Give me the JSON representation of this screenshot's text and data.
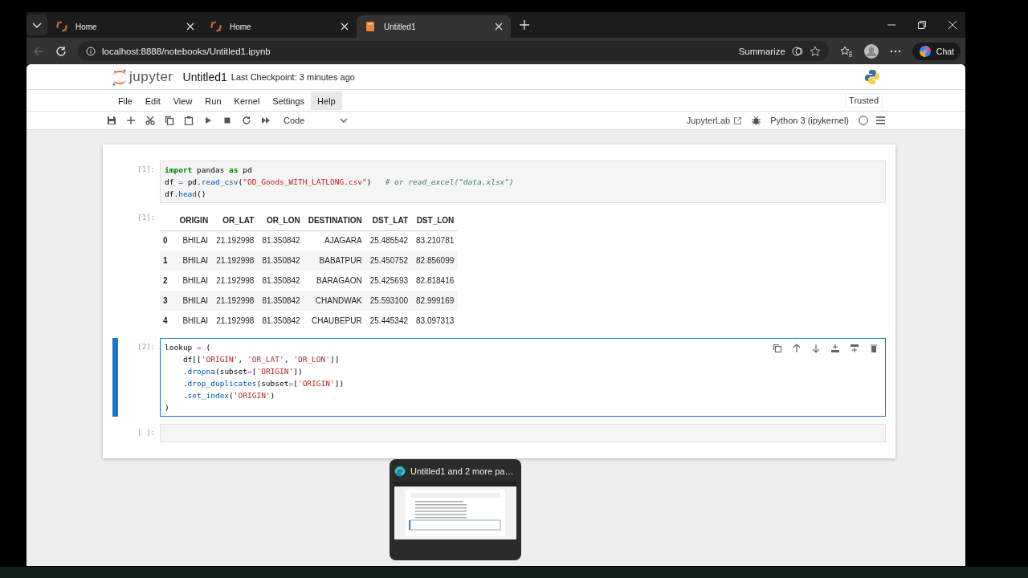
{
  "browser": {
    "tabs": [
      {
        "title": "Home",
        "kind": "jupyter",
        "selected": false
      },
      {
        "title": "Home",
        "kind": "jupyter",
        "selected": false
      },
      {
        "title": "Untitled1",
        "kind": "notebook",
        "selected": true
      }
    ],
    "url": "localhost:8888/notebooks/Untitled1.ipynb",
    "summarize": "Summarize",
    "chat": "Chat"
  },
  "jupyter": {
    "logo": "jupyter",
    "notebook_title": "Untitled1",
    "checkpoint": "Last Checkpoint: 3 minutes ago",
    "menu": [
      {
        "label": "File",
        "selected": false
      },
      {
        "label": "Edit",
        "selected": false
      },
      {
        "label": "View",
        "selected": false
      },
      {
        "label": "Run",
        "selected": false
      },
      {
        "label": "Kernel",
        "selected": false
      },
      {
        "label": "Settings",
        "selected": false
      },
      {
        "label": "Help",
        "selected": true
      }
    ],
    "trusted": "Trusted",
    "cell_type": "Code",
    "jupyterlab": "JupyterLab",
    "kernel": "Python 3 (ipykernel)"
  },
  "cells": [
    {
      "prompt": "[1]:",
      "selected": false,
      "lines": [
        [
          {
            "kind": "kw",
            "text": "import"
          },
          {
            "kind": "plain",
            "text": " pandas "
          },
          {
            "kind": "kw",
            "text": "as"
          },
          {
            "kind": "plain",
            "text": " pd"
          }
        ],
        [
          {
            "kind": "plain",
            "text": "df "
          },
          {
            "kind": "op",
            "text": "="
          },
          {
            "kind": "plain",
            "text": " pd."
          },
          {
            "kind": "fn",
            "text": "read_csv"
          },
          {
            "kind": "plain",
            "text": "("
          },
          {
            "kind": "str",
            "text": "\"OD_Goods_WITH_LATLONG.csv\""
          },
          {
            "kind": "plain",
            "text": ")   "
          },
          {
            "kind": "cmt",
            "text": "# or read_excel(\"data.xlsx\")"
          }
        ],
        [
          {
            "kind": "plain",
            "text": "df."
          },
          {
            "kind": "fn",
            "text": "head"
          },
          {
            "kind": "plain",
            "text": "()"
          }
        ]
      ],
      "output": {
        "prompt": "[1]:",
        "columns": [
          "ORIGIN",
          "OR_LAT",
          "OR_LON",
          "DESTINATION",
          "DST_LAT",
          "DST_LON"
        ],
        "rows": [
          {
            "index": "0",
            "values": [
              "BHILAI",
              "21.192998",
              "81.350842",
              "AJAGARA",
              "25.485542",
              "83.210781"
            ]
          },
          {
            "index": "1",
            "values": [
              "BHILAI",
              "21.192998",
              "81.350842",
              "BABATPUR",
              "25.450752",
              "82.856099"
            ]
          },
          {
            "index": "2",
            "values": [
              "BHILAI",
              "21.192998",
              "81.350842",
              "BARAGAON",
              "25.425693",
              "82.818416"
            ]
          },
          {
            "index": "3",
            "values": [
              "BHILAI",
              "21.192998",
              "81.350842",
              "CHANDWAK",
              "25.593100",
              "82.999169"
            ]
          },
          {
            "index": "4",
            "values": [
              "BHILAI",
              "21.192998",
              "81.350842",
              "CHAUBEPUR",
              "25.445342",
              "83.097313"
            ]
          }
        ]
      }
    },
    {
      "prompt": "[2]:",
      "selected": true,
      "lines": [
        [
          {
            "kind": "plain",
            "text": "lookup "
          },
          {
            "kind": "op",
            "text": "="
          },
          {
            "kind": "plain",
            "text": " ("
          }
        ],
        [
          {
            "kind": "plain",
            "text": "    df[["
          },
          {
            "kind": "str",
            "text": "'ORIGIN'"
          },
          {
            "kind": "plain",
            "text": ", "
          },
          {
            "kind": "str",
            "text": "'OR_LAT'"
          },
          {
            "kind": "plain",
            "text": ", "
          },
          {
            "kind": "str",
            "text": "'OR_LON'"
          },
          {
            "kind": "plain",
            "text": "]]"
          }
        ],
        [
          {
            "kind": "plain",
            "text": "    ."
          },
          {
            "kind": "fn",
            "text": "dropna"
          },
          {
            "kind": "plain",
            "text": "(subset"
          },
          {
            "kind": "op",
            "text": "="
          },
          {
            "kind": "plain",
            "text": "["
          },
          {
            "kind": "str",
            "text": "'ORIGIN'"
          },
          {
            "kind": "plain",
            "text": "])"
          }
        ],
        [
          {
            "kind": "plain",
            "text": "    ."
          },
          {
            "kind": "fn",
            "text": "drop_duplicates"
          },
          {
            "kind": "plain",
            "text": "(subset"
          },
          {
            "kind": "op",
            "text": "="
          },
          {
            "kind": "plain",
            "text": "["
          },
          {
            "kind": "str",
            "text": "'ORIGIN'"
          },
          {
            "kind": "plain",
            "text": "])"
          }
        ],
        [
          {
            "kind": "plain",
            "text": "    ."
          },
          {
            "kind": "fn",
            "text": "set_index"
          },
          {
            "kind": "plain",
            "text": "("
          },
          {
            "kind": "str",
            "text": "'ORIGIN'"
          },
          {
            "kind": "plain",
            "text": ")"
          }
        ],
        [
          {
            "kind": "plain",
            "text": ")"
          }
        ]
      ]
    },
    {
      "prompt": "[ ]:",
      "selected": false
    }
  ],
  "taskbar_preview": {
    "title": "Untitled1 and 2 more pa…"
  }
}
